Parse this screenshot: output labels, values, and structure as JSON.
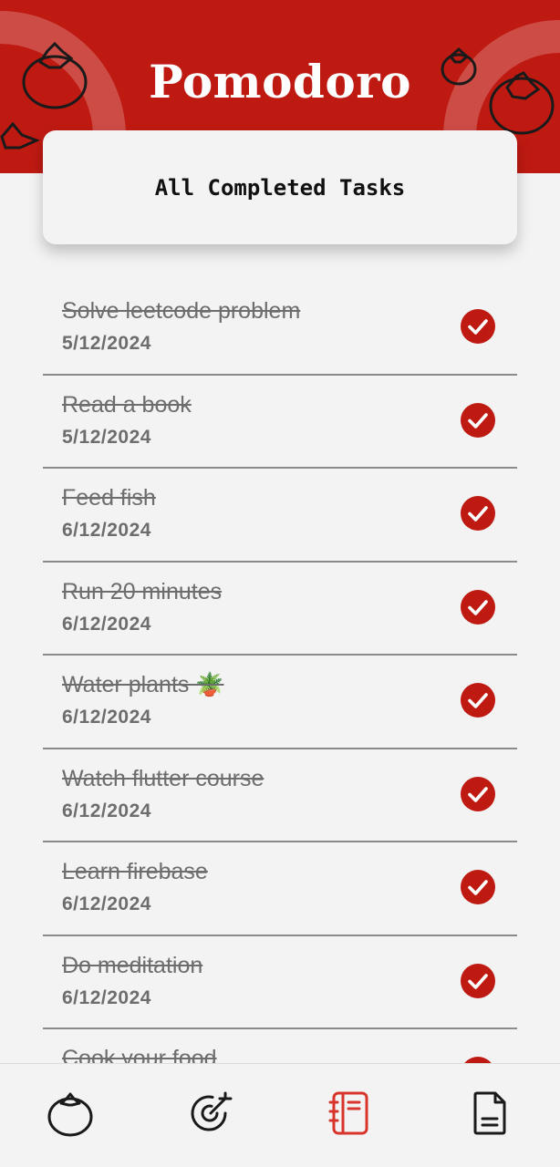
{
  "app": {
    "title": "Pomodoro"
  },
  "section": {
    "title": "All Completed Tasks"
  },
  "tasks": [
    {
      "name": "Solve leetcode problem",
      "date": "5/12/2024"
    },
    {
      "name": "Read a book",
      "date": "5/12/2024"
    },
    {
      "name": "Feed fish",
      "date": "6/12/2024"
    },
    {
      "name": "Run 20 minutes",
      "date": "6/12/2024"
    },
    {
      "name": "Water plants 🪴",
      "date": "6/12/2024"
    },
    {
      "name": "Watch flutter course",
      "date": "6/12/2024"
    },
    {
      "name": "Learn firebase",
      "date": "6/12/2024"
    },
    {
      "name": "Do meditation",
      "date": "6/12/2024"
    },
    {
      "name": "Cook your food",
      "date": ""
    }
  ],
  "nav": [
    {
      "icon": "tomato-icon",
      "active": false
    },
    {
      "icon": "target-icon",
      "active": false
    },
    {
      "icon": "notebook-icon",
      "active": true
    },
    {
      "icon": "document-icon",
      "active": false
    }
  ],
  "colors": {
    "primary": "#bf1a12",
    "background": "#f3f3f3",
    "text_muted": "#6d6d6d"
  }
}
